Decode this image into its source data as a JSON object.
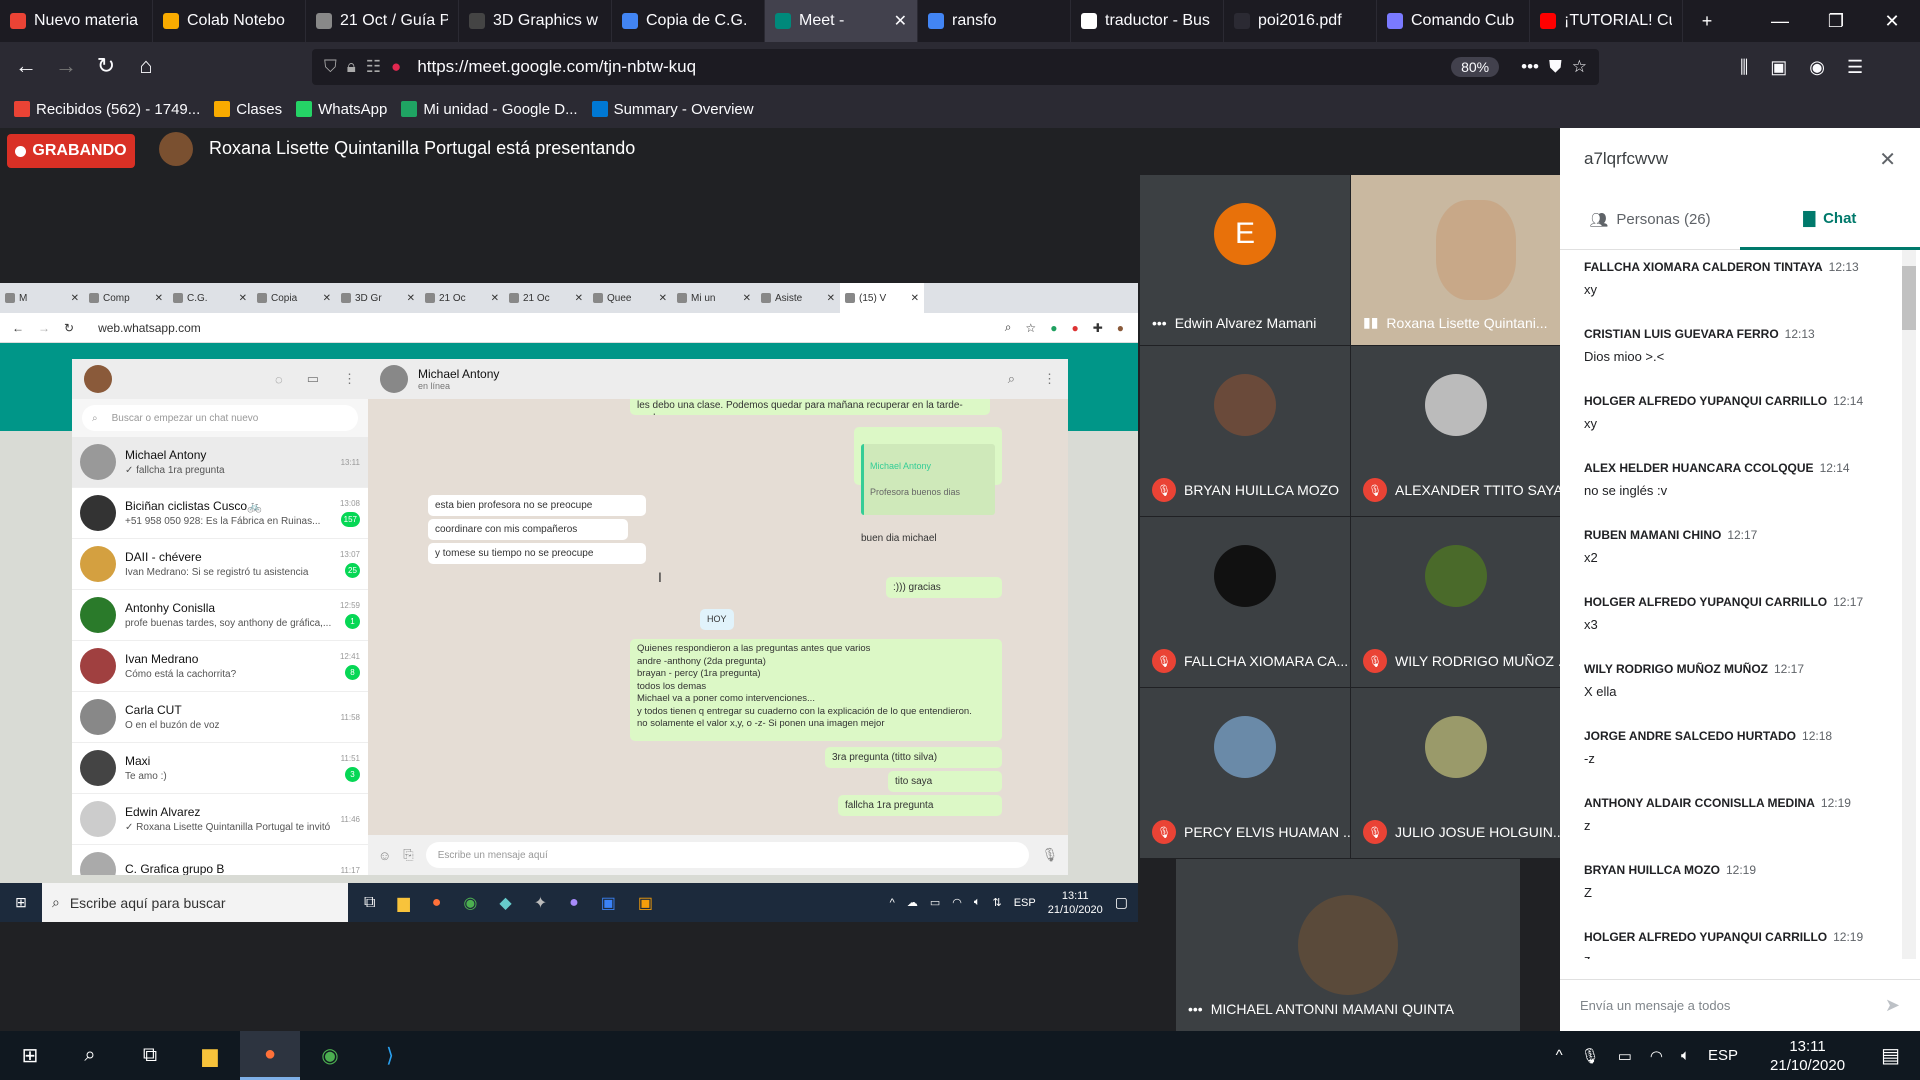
{
  "firefox": {
    "tabs": [
      {
        "label": "Nuevo materia",
        "color": "#ea4335"
      },
      {
        "label": "Colab Notebo",
        "color": "#f9ab00"
      },
      {
        "label": "21 Oct / Guía P",
        "color": "#888888"
      },
      {
        "label": "3D Graphics w",
        "color": "#444444"
      },
      {
        "label": "Copia de C.G.",
        "color": "#4285f4"
      },
      {
        "label": "Meet -",
        "color": "#00897b"
      },
      {
        "label": "ransfo",
        "color": "#4285f4"
      },
      {
        "label": "traductor - Bus",
        "color": "#ffffff"
      },
      {
        "label": "poi2016.pdf",
        "color": "#2b2a33"
      },
      {
        "label": "Comando Cub",
        "color": "#7a7aff"
      },
      {
        "label": "¡TUTORIAL! Cu",
        "color": "#ff0000"
      }
    ],
    "url": "https://meet.google.com/tjn-nbtw-kuq",
    "zoom": "80%",
    "bookmarks": [
      {
        "label": "Recibidos (562) - 1749...",
        "color": "#ea4335"
      },
      {
        "label": "Clases",
        "color": "#f9ab00"
      },
      {
        "label": "WhatsApp",
        "color": "#25d366"
      },
      {
        "label": "Mi unidad - Google D...",
        "color": "#1fa463"
      },
      {
        "label": "Summary - Overview",
        "color": "#0078d4"
      }
    ]
  },
  "meet": {
    "recording": "GRABANDO",
    "presenting": "Roxana Lisette Quintanilla Portugal está presentando",
    "meeting_code": "a7lqrfcwvw",
    "tab_people": "Personas (26)",
    "tab_chat": "Chat",
    "chat_placeholder": "Envía un mensaje a todos",
    "participants": [
      {
        "name": "Edwin Alvarez Mamani",
        "initial": "E"
      },
      {
        "name": "Roxana Lisette Quintani..."
      },
      {
        "name": "BRYAN HUILLCA MOZO"
      },
      {
        "name": "ALEXANDER TTITO SAYA"
      },
      {
        "name": "FALLCHA XIOMARA CA..."
      },
      {
        "name": "WILY RODRIGO MUÑOZ ..."
      },
      {
        "name": "PERCY ELVIS HUAMAN ..."
      },
      {
        "name": "JULIO JOSUE HOLGUIN..."
      },
      {
        "name": "MICHAEL ANTONNI MAMANI QUINTA"
      }
    ],
    "messages": [
      {
        "who": "FALLCHA XIOMARA CALDERON TINTAYA",
        "time": "12:13",
        "text": "xy"
      },
      {
        "who": "CRISTIAN LUIS GUEVARA FERRO",
        "time": "12:13",
        "text": "Dios mioo >.<"
      },
      {
        "who": "HOLGER ALFREDO YUPANQUI CARRILLO",
        "time": "12:14",
        "text": "xy"
      },
      {
        "who": "ALEX HELDER HUANCARA CCOLQQUE",
        "time": "12:14",
        "text": "no se inglés :v"
      },
      {
        "who": "RUBEN MAMANI CHINO",
        "time": "12:17",
        "text": "x2"
      },
      {
        "who": "HOLGER ALFREDO YUPANQUI CARRILLO",
        "time": "12:17",
        "text": "x3"
      },
      {
        "who": "WILY RODRIGO MUÑOZ MUÑOZ",
        "time": "12:17",
        "text": "X ella"
      },
      {
        "who": "JORGE ANDRE SALCEDO HURTADO",
        "time": "12:18",
        "text": "-z"
      },
      {
        "who": "ANTHONY ALDAIR CCONISLLA MEDINA",
        "time": "12:19",
        "text": "z"
      },
      {
        "who": "BRYAN HUILLCA MOZO",
        "time": "12:19",
        "text": "Z"
      },
      {
        "who": "HOLGER ALFREDO YUPANQUI CARRILLO",
        "time": "12:19",
        "text": "z"
      }
    ]
  },
  "shared": {
    "tabs": [
      "M",
      "Comp",
      "C.G.",
      "Copia",
      "3D Gr",
      "21 Oc",
      "21 Oc",
      "Quee",
      "Mi un",
      "Asiste",
      "(15) V"
    ],
    "url": "web.whatsapp.com",
    "search_placeholder": "Buscar o empezar un chat nuevo",
    "chat_header_name": "Michael Antony",
    "chat_header_status": "en línea",
    "compose_placeholder": "Escribe un mensaje aquí",
    "chats": [
      {
        "name": "Michael Antony",
        "preview": "✓ fallcha 1ra pregunta",
        "time": "13:11",
        "badge": ""
      },
      {
        "name": "Biciñan ciclistas Cusco🚲",
        "preview": "+51 958 050 928: Es la Fábrica en Ruinas...",
        "time": "13:08",
        "badge": "157"
      },
      {
        "name": "DAII - chévere",
        "preview": "Ivan Medrano: Si se registró tu asistencia",
        "time": "13:07",
        "badge": "25"
      },
      {
        "name": "Antonhy Conislla",
        "preview": "profe buenas tardes, soy anthony de gráfica,...",
        "time": "12:59",
        "badge": "1"
      },
      {
        "name": "Ivan Medrano",
        "preview": "Cómo está la cachorrita?",
        "time": "12:41",
        "badge": "8"
      },
      {
        "name": "Carla CUT",
        "preview": "O en el buzón de voz",
        "time": "11:58",
        "badge": ""
      },
      {
        "name": "Maxi",
        "preview": "Te amo :)",
        "time": "11:51",
        "badge": "3"
      },
      {
        "name": "Edwin Alvarez",
        "preview": "✓ Roxana Lisette Quintanilla Portugal te invitó a ...",
        "time": "11:46",
        "badge": ""
      },
      {
        "name": "C. Grafica grupo B",
        "preview": "",
        "time": "11:17",
        "badge": ""
      }
    ],
    "bubbles": {
      "top_cut": "les debo una clase. Podemos quedar para mañana recuperar en la tarde-noche.",
      "quote_name": "Michael Antony",
      "quote_text": "Profesora buenos dias",
      "reply": "buen dia michael",
      "in1": "esta bien profesora no se preocupe",
      "in2": "coordinare con mis compañeros",
      "in3": "y tomese su tiempo no se preocupe",
      "gracias": ":))) gracias",
      "day": "HOY",
      "long": "Quienes respondieron  a las preguntas antes que varios\nandre -anthony (2da pregunta)\nbrayan - percy (1ra pregunta)\ntodos los demas\nMichael va a poner como intervenciones...\ny todos tienen q entregar su cuaderno con la explicación de lo que entendieron.\nno solamente el valor x,y, o -z-  Si ponen una imagen mejor",
      "o1": "3ra pregunta (titto silva)",
      "o2": "tito saya",
      "o3": "fallcha 1ra pregunta"
    },
    "inner_taskbar": {
      "search": "Escribe aquí para buscar",
      "lang": "ESP",
      "time": "13:11",
      "date": "21/10/2020"
    }
  },
  "taskbar": {
    "lang": "ESP",
    "time": "13:11",
    "date": "21/10/2020"
  }
}
